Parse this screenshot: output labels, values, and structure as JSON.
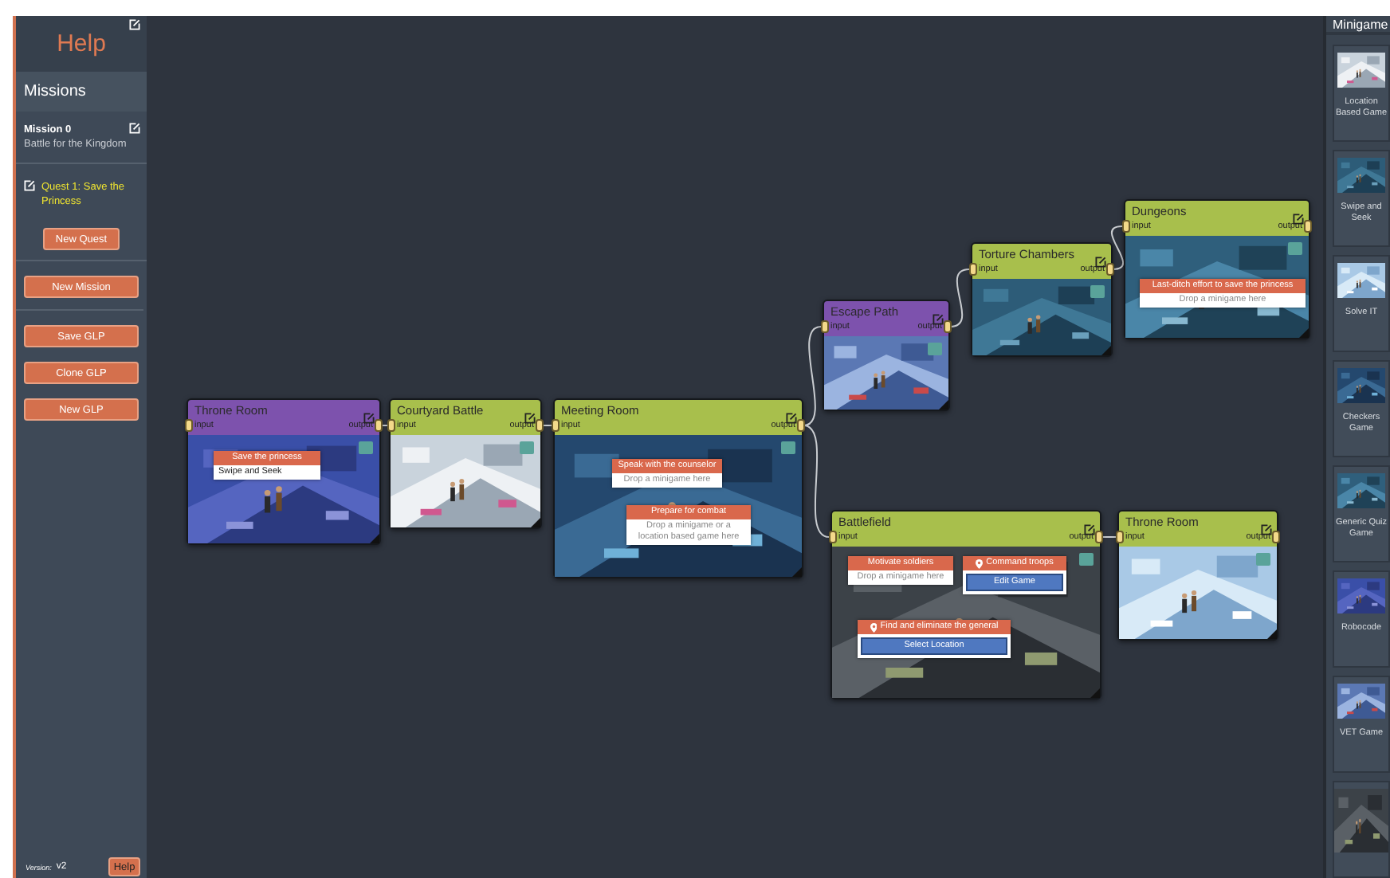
{
  "sidebar": {
    "title": "Help",
    "section": "Missions",
    "mission": {
      "title": "Mission 0",
      "subtitle": "Battle for the Kingdom"
    },
    "quests": [
      {
        "label": "Quest 1: Save the Princess"
      }
    ],
    "new_quest": "New Quest",
    "mission_button": "New Mission",
    "buttons": [
      "Save GLP",
      "Clone GLP",
      "New GLP"
    ],
    "version_label": "Version:",
    "version": "v2",
    "help_button": "Help"
  },
  "nodes": [
    {
      "title": "Throne Room",
      "color": "#7d52ad",
      "input": "input",
      "output": "output",
      "tasks": [
        {
          "title": "Save the princess",
          "kind": "game",
          "body": "Swipe and Seek",
          "pin": false
        }
      ]
    },
    {
      "title": "Courtyard Battle",
      "color": "#a8bf4c",
      "input": "input",
      "output": "output"
    },
    {
      "title": "Meeting Room",
      "color": "#a8bf4c",
      "input": "input",
      "output": "output",
      "tasks": [
        {
          "title": "Speak with the counselor",
          "kind": "drop",
          "body": "Drop a minigame here",
          "pin": false
        },
        {
          "title": "Prepare for combat",
          "kind": "drop",
          "body": "Drop a minigame or a location based game here",
          "pin": false
        }
      ]
    },
    {
      "title": "Escape Path",
      "color": "#7d52ad",
      "input": "input",
      "output": "output"
    },
    {
      "title": "Torture Chambers",
      "color": "#a8bf4c",
      "input": "input",
      "output": "output"
    },
    {
      "title": "Dungeons",
      "color": "#a8bf4c",
      "input": "input",
      "output": "output",
      "tasks": [
        {
          "title": "Last-ditch effort to save the princess",
          "kind": "drop",
          "body": "Drop a minigame here",
          "pin": false
        }
      ]
    },
    {
      "title": "Battlefield",
      "color": "#a8bf4c",
      "input": "input",
      "output": "output",
      "tasks": [
        {
          "title": "Motivate soldiers",
          "kind": "drop",
          "body": "Drop a minigame here",
          "pin": false
        },
        {
          "title": "Command troops",
          "kind": "button",
          "body": "Edit Game",
          "pin": true
        },
        {
          "title": "Find and eliminate the general",
          "kind": "button",
          "body": "Select Location",
          "pin": true
        }
      ]
    },
    {
      "title": "Throne Room",
      "color": "#a8bf4c",
      "input": "input",
      "output": "output"
    }
  ],
  "minigames": {
    "title": "Minigame",
    "items": [
      {
        "label": "Location Based Game"
      },
      {
        "label": "Swipe and Seek"
      },
      {
        "label": "Solve IT"
      },
      {
        "label": "Checkers Game"
      },
      {
        "label": "Generic Quiz Game"
      },
      {
        "label": "Robocode"
      },
      {
        "label": "VET Game"
      },
      {
        "kind": "picture"
      }
    ]
  }
}
